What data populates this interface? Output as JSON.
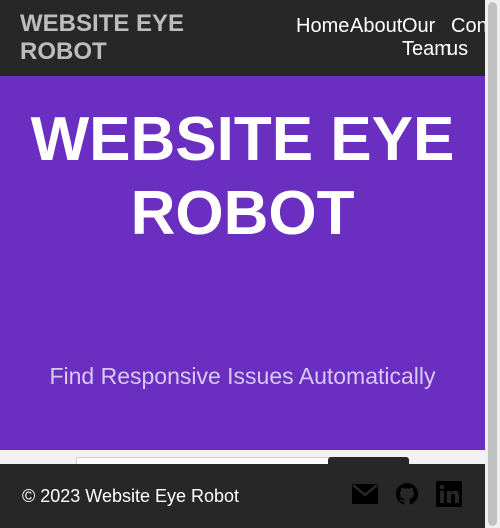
{
  "header": {
    "brand": "WEBSITE EYE ROBOT",
    "nav": {
      "home": "Home",
      "about": "About",
      "our_team_line1": "Our",
      "our_team_line2": "Team",
      "contact_line2": "us",
      "contact": "Con"
    }
  },
  "hero": {
    "title": "WEBSITE EYE ROBOT",
    "subtitle": "Find Responsive Issues Automatically"
  },
  "footer": {
    "copyright": "© 2023 Website Eye Robot",
    "icons": [
      "mail-icon",
      "github-icon",
      "linkedin-icon"
    ]
  },
  "colors": {
    "header_bg": "#272727",
    "hero_bg": "#6a2ec1",
    "brand_text": "#bdbdbd",
    "subtitle_text": "#d9c9f2"
  }
}
